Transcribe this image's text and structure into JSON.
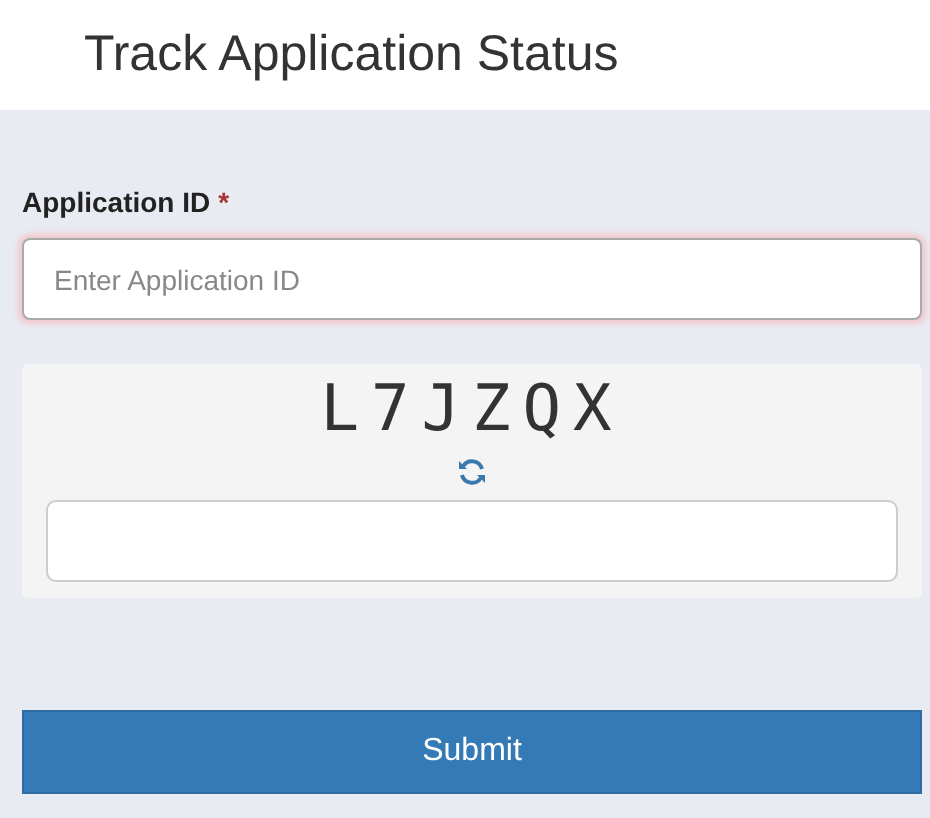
{
  "header": {
    "title": "Track Application Status"
  },
  "form": {
    "label": "Application ID",
    "required_mark": "*",
    "placeholder": "Enter Application ID"
  },
  "captcha": {
    "code": "L7JZQX"
  },
  "buttons": [
    "Submit"
  ]
}
